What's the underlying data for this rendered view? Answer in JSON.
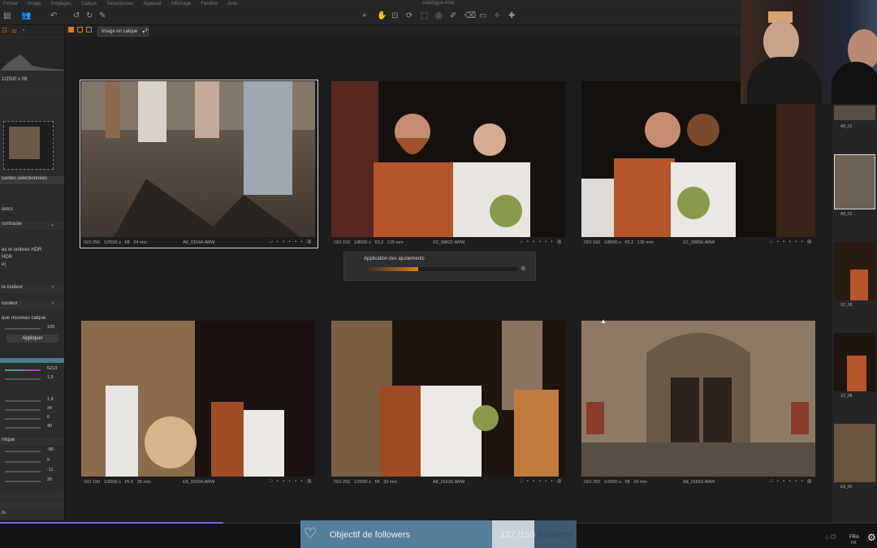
{
  "menubar": {
    "items": [
      "Fichier",
      "Image",
      "Réglages",
      "Calque",
      "Sélectionner",
      "Appareil",
      "Affichage",
      "Fenêtre",
      "Aide"
    ],
    "title": "catalogue-lmta"
  },
  "viewbar": {
    "view_select": "Image en calque"
  },
  "left_panel": {
    "exposure_readout": "1/2500 s    f/8",
    "selection_label": "santes sélectionnées",
    "labels": [
      "lancs",
      "contraste",
      "es et ombres HDR",
      "HDR",
      "e)",
      "la couleur",
      "couleur",
      "que nouveau calque",
      "Appliquer",
      "mique",
      "rs"
    ],
    "values": [
      "100",
      "5213",
      "1,5",
      "1,8",
      "34",
      "0",
      "40",
      "-85",
      "9",
      "-11",
      "20"
    ]
  },
  "thumbnails": [
    {
      "iso": "ISO 250",
      "shutter": "1/2500 s",
      "aperture": "f/8",
      "focal": "24 mm",
      "file": "A8_01544.ARW",
      "selected": true
    },
    {
      "iso": "ISO 160",
      "shutter": "1/8000 s",
      "aperture": "f/3.2",
      "focal": "135 mm",
      "file": "X2_08822.ARW",
      "selected": false
    },
    {
      "iso": "ISO 160",
      "shutter": "1/8000 s",
      "aperture": "f/3.2",
      "focal": "135 mm",
      "file": "X2_08856.ARW",
      "selected": false
    },
    {
      "iso": "ISO 100",
      "shutter": "1/2000 s",
      "aperture": "f/5.6",
      "focal": "35 mm",
      "file": "E8_00159.ARW",
      "selected": false
    },
    {
      "iso": "ISO 250",
      "shutter": "1/2500 s",
      "aperture": "f/8",
      "focal": "33 mm",
      "file": "A8_01639.ARW",
      "selected": false
    },
    {
      "iso": "ISO 250",
      "shutter": "1/2500 s",
      "aperture": "f/8",
      "focal": "24 mm",
      "file": "A8_01653.ARW",
      "selected": false
    }
  ],
  "progress_dialog": {
    "title": "Application des ajustements",
    "progress": 0.35
  },
  "right_strip": {
    "labels": [
      "A8_01",
      "A8_01",
      "X2_08",
      "X2_08",
      "E8_00"
    ]
  },
  "followers": {
    "label": "Objectif de followers",
    "current": "127",
    "goal": "/150",
    "suffix": "followers",
    "progress": 0.847
  },
  "taskbar": {
    "lang": "FRA",
    "lang2": "FR"
  },
  "colors": {
    "accent_orange": "#e07a1f",
    "follower_bar": "#3d5a70",
    "purple_progress": "#8a5ad6"
  }
}
